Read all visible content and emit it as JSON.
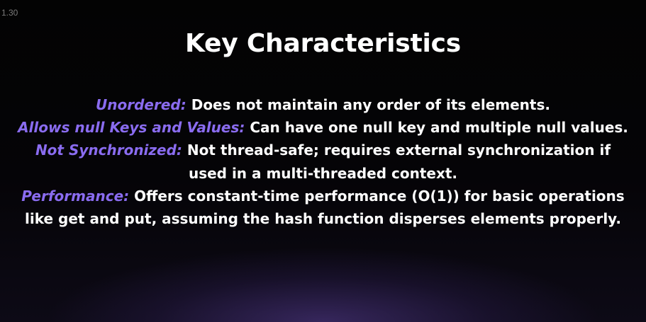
{
  "version_label": "1.30",
  "title": "Key Characteristics",
  "colors": {
    "background": "#000000",
    "accent_purple": "#8a6cf0",
    "text": "#ffffff"
  },
  "points": [
    {
      "term": "Unordered:",
      "description": "Does not maintain any order of its elements."
    },
    {
      "term": "Allows null Keys and Values:",
      "description": "Can have one null key and multiple null values."
    },
    {
      "term": "Not Synchronized:",
      "description": "Not thread-safe; requires external synchronization if used in a multi-threaded context."
    },
    {
      "term": "Performance:",
      "description": "Offers constant-time performance (O(1)) for basic operations like get and put, assuming the hash function disperses elements properly."
    }
  ]
}
